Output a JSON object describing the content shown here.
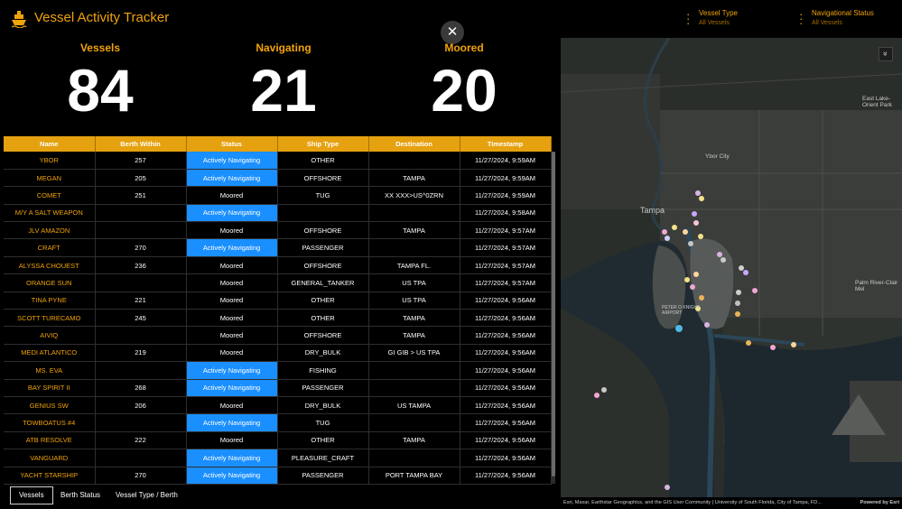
{
  "header": {
    "title": "Vessel Activity Tracker",
    "filters": [
      {
        "label": "Vessel Type",
        "value": "All Vessels"
      },
      {
        "label": "Navigational Status",
        "value": "All Vessels"
      }
    ]
  },
  "close_glyph": "✕",
  "kpis": [
    {
      "label": "Vessels",
      "value": "84"
    },
    {
      "label": "Navigating",
      "value": "21"
    },
    {
      "label": "Moored",
      "value": "20"
    }
  ],
  "table": {
    "columns": [
      "Name",
      "Berth Within",
      "Status",
      "Ship Type",
      "Destination",
      "Timestamp"
    ],
    "rows": [
      [
        "YBOR",
        "257",
        "Actively Navigating",
        "OTHER",
        "",
        "11/27/2024, 9:59AM"
      ],
      [
        "MEGAN",
        "205",
        "Actively Navigating",
        "OFFSHORE",
        "TAMPA",
        "11/27/2024, 9:59AM"
      ],
      [
        "COMET",
        "251",
        "Moored",
        "TUG",
        "XX XXX>US^0ZRN",
        "11/27/2024, 9:59AM"
      ],
      [
        "M/Y A SALT WEAPON",
        "",
        "Actively Navigating",
        "",
        "",
        "11/27/2024, 9:58AM"
      ],
      [
        "JLV AMAZON",
        "",
        "Moored",
        "OFFSHORE",
        "TAMPA",
        "11/27/2024, 9:57AM"
      ],
      [
        "CRAFT",
        "270",
        "Actively Navigating",
        "PASSENGER",
        "",
        "11/27/2024, 9:57AM"
      ],
      [
        "ALYSSA CHOUEST",
        "236",
        "Moored",
        "OFFSHORE",
        "TAMPA FL.",
        "11/27/2024, 9:57AM"
      ],
      [
        "ORANGE SUN",
        "",
        "Moored",
        "GENERAL_TANKER",
        "US TPA",
        "11/27/2024, 9:57AM"
      ],
      [
        "TINA PYNE",
        "221",
        "Moored",
        "OTHER",
        "US TPA",
        "11/27/2024, 9:56AM"
      ],
      [
        "SCOTT TURECAMO",
        "245",
        "Moored",
        "OTHER",
        "TAMPA",
        "11/27/2024, 9:56AM"
      ],
      [
        "AIVIQ",
        "",
        "Moored",
        "OFFSHORE",
        "TAMPA",
        "11/27/2024, 9:56AM"
      ],
      [
        "MEDI ATLANTICO",
        "219",
        "Moored",
        "DRY_BULK",
        "GI GIB > US TPA",
        "11/27/2024, 9:56AM"
      ],
      [
        "MS. EVA",
        "",
        "Actively Navigating",
        "FISHING",
        "",
        "11/27/2024, 9:56AM"
      ],
      [
        "BAY SPIRIT II",
        "268",
        "Actively Navigating",
        "PASSENGER",
        "",
        "11/27/2024, 9:56AM"
      ],
      [
        "GENIUS SW",
        "206",
        "Moored",
        "DRY_BULK",
        "US TAMPA",
        "11/27/2024, 9:56AM"
      ],
      [
        "TOWBOATUS #4",
        "",
        "Actively Navigating",
        "TUG",
        "",
        "11/27/2024, 9:56AM"
      ],
      [
        "ATB RESOLVE",
        "222",
        "Moored",
        "OTHER",
        "TAMPA",
        "11/27/2024, 9:56AM"
      ],
      [
        "VANGUARD",
        "",
        "Actively Navigating",
        "PLEASURE_CRAFT",
        "",
        "11/27/2024, 9:56AM"
      ],
      [
        "YACHT STARSHIP",
        "270",
        "Actively Navigating",
        "PASSENGER",
        "PORT TAMPA BAY",
        "11/27/2024, 9:56AM"
      ]
    ]
  },
  "tabs": [
    "Vessels",
    "Berth Status",
    "Vessel Type / Berth"
  ],
  "map": {
    "labels": [
      "Tampa",
      "Ybor City",
      "East Lake-Orient Park",
      "Palm River-Clair Mel",
      "PETER O KNIGHT AIRPORT"
    ],
    "expand_glyph": "»",
    "attribution": "Esri, Maxar, Earthstar Geographics, and the GIS User Community | University of South Florida, City of Tampa, FD...",
    "powered_by": "Powered by Esri"
  },
  "colors": {
    "accent": "#f0a30a",
    "navigating": "#1a8fff"
  }
}
